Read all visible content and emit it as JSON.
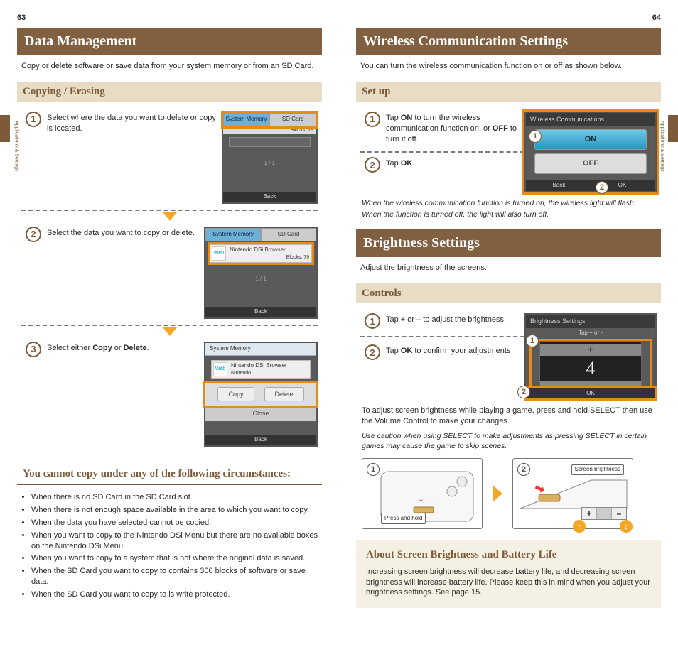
{
  "pages": {
    "left": "63",
    "right": "64"
  },
  "sideLabel": "Applications & Settings",
  "dm": {
    "title": "Data Management",
    "intro": "Copy or delete software or save data from your system memory or from an SD Card.",
    "sub": "Copying / Erasing",
    "step1": "Select where the data you want to delete or copy is located.",
    "step2": "Select the data you want to copy or delete.",
    "step3_pre": "Select either ",
    "step3_b1": "Copy",
    "step3_mid": " or ",
    "step3_b2": "Delete",
    "step3_post": ".",
    "shot": {
      "sysmem": "System Memory",
      "sdcard": "SD Card",
      "browser": "Nintendo DSi Browser",
      "vendor": "Nintendo",
      "blocks": "Blocks: 79",
      "pager": "1 / 1",
      "back": "Back",
      "copy": "Copy",
      "delete": "Delete",
      "close": "Close",
      "web": "Web"
    },
    "warnTitle": "You cannot copy under any of the following circumstances:",
    "warn": [
      "When there is no SD Card in the SD Card slot.",
      "When there is not enough space available in the area to which you want to copy.",
      "When the data you have selected cannot be copied.",
      "When you want to copy to the Nintendo DSi Menu but there are no available boxes on the Nintendo DSi Menu.",
      "When you want to copy to a system that is not where the original data is saved.",
      "When the SD Card you want to copy to contains 300 blocks of software or save data.",
      "When the SD Card you want to copy to is write protected."
    ]
  },
  "wc": {
    "title": "Wireless Communication Settings",
    "intro": "You can turn the wireless communication function on or off as shown below.",
    "sub": "Set up",
    "step1_pre": "Tap ",
    "step1_on": "ON",
    "step1_mid": " to turn the wireless communication function on, or ",
    "step1_off": "OFF",
    "step1_post": " to turn it off.",
    "step2_pre": "Tap ",
    "step2_ok": "OK",
    "step2_post": ".",
    "note1": "When the wireless communication function is turned on, the wireless light will flash.",
    "note2": "When the function is turned off, the light will also turn off.",
    "shot": {
      "title": "Wireless Communications",
      "on": "ON",
      "off": "OFF",
      "back": "Back",
      "ok": "OK"
    }
  },
  "br": {
    "title": "Brightness Settings",
    "intro": "Adjust the brightness of the screens.",
    "sub": "Controls",
    "step1": "Tap + or – to adjust the brightness.",
    "step2_pre": "Tap ",
    "step2_ok": "OK",
    "step2_post": " to confirm your adjustments",
    "shot": {
      "title": "Brightness Settings",
      "tap": "Tap + or -",
      "plus": "+",
      "value": "4",
      "minus": "-",
      "ok": "OK"
    },
    "tip": "To adjust screen brightness while playing a game, press and hold SELECT then use the Volume Control to make your changes.",
    "tipNote": "Use caution when using SELECT to make adjustments as pressing SELECT in certain games may cause the game to skip scenes.",
    "device": {
      "press": "Press and hold",
      "screenBrightness": "Screen brightness",
      "plus": "+",
      "minus": "–",
      "up": "↑",
      "down": "↓"
    },
    "about": {
      "title": "About Screen Brightness and Battery Life",
      "body": "Increasing screen brightness will decrease battery life, and decreasing screen brightness will increase battery life. Please keep this in mind when you adjust your brightness settings. See page 15."
    }
  },
  "nums": {
    "n1": "1",
    "n2": "2",
    "n3": "3"
  }
}
